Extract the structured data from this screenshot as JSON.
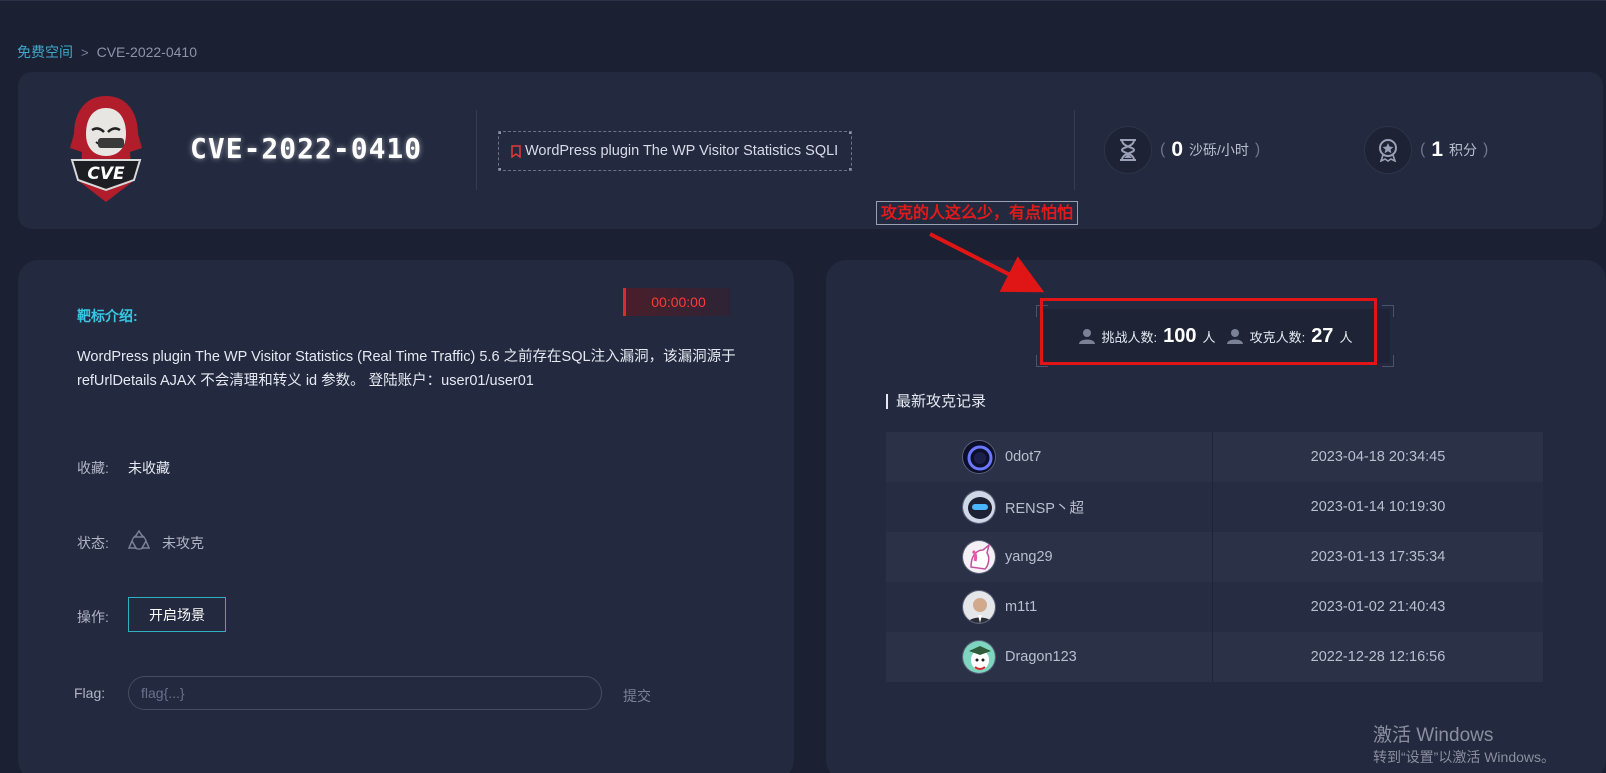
{
  "breadcrumb": {
    "parent": "免费空间",
    "separator": ">",
    "current": "CVE-2022-0410"
  },
  "header": {
    "logo_text": "CVE",
    "title": "CVE-2022-0410",
    "tag": "WordPress plugin The WP Visitor Statistics SQLI",
    "sand": {
      "open": "(",
      "value": "0",
      "unit": "沙砾/小时",
      "close": ")"
    },
    "points": {
      "open": "(",
      "value": "1",
      "unit": "积分",
      "close": ")"
    }
  },
  "annotation": {
    "text": "攻克的人这么少，有点怕怕",
    "color": "#e11a1a"
  },
  "target": {
    "timer": "00:00:00",
    "intro_title": "靶标介绍:",
    "intro_text": "WordPress plugin The WP Visitor Statistics (Real Time Traffic) 5.6 之前存在SQL注入漏洞，该漏洞源于 refUrlDetails AJAX 不会清理和转义 id 参数。 登陆账户：user01/user01",
    "favorite_label": "收藏:",
    "favorite_value": "未收藏",
    "status_label": "状态:",
    "status_value": "未攻克",
    "action_label": "操作:",
    "start_button": "开启场景",
    "flag_label": "Flag:",
    "flag_placeholder": "flag{...}",
    "submit": "提交"
  },
  "stats": {
    "challengers_label": "挑战人数:",
    "challengers": "100",
    "challengers_unit": "人",
    "solvers_label": "攻克人数:",
    "solvers": "27",
    "solvers_unit": "人"
  },
  "records": {
    "title": "最新攻克记录",
    "rows": [
      {
        "user": "0dot7",
        "time": "2023-04-18 20:34:45"
      },
      {
        "user": "RENSP丶超",
        "time": "2023-01-14 10:19:30"
      },
      {
        "user": "yang29",
        "time": "2023-01-13 17:35:34"
      },
      {
        "user": "m1t1",
        "time": "2023-01-02 21:40:43"
      },
      {
        "user": "Dragon123",
        "time": "2022-12-28 12:16:56"
      }
    ]
  },
  "watermark": {
    "line1": "激活 Windows",
    "line2": "转到“设置”以激活 Windows。"
  },
  "colors": {
    "accent": "#38c7e2",
    "danger": "#e01515",
    "background": "#1b2032",
    "card": "#232a3f"
  },
  "icons": [
    "chevron-right-icon",
    "bookmark-icon",
    "hourglass-icon",
    "medal-icon",
    "recycle-icon",
    "user-icon"
  ]
}
